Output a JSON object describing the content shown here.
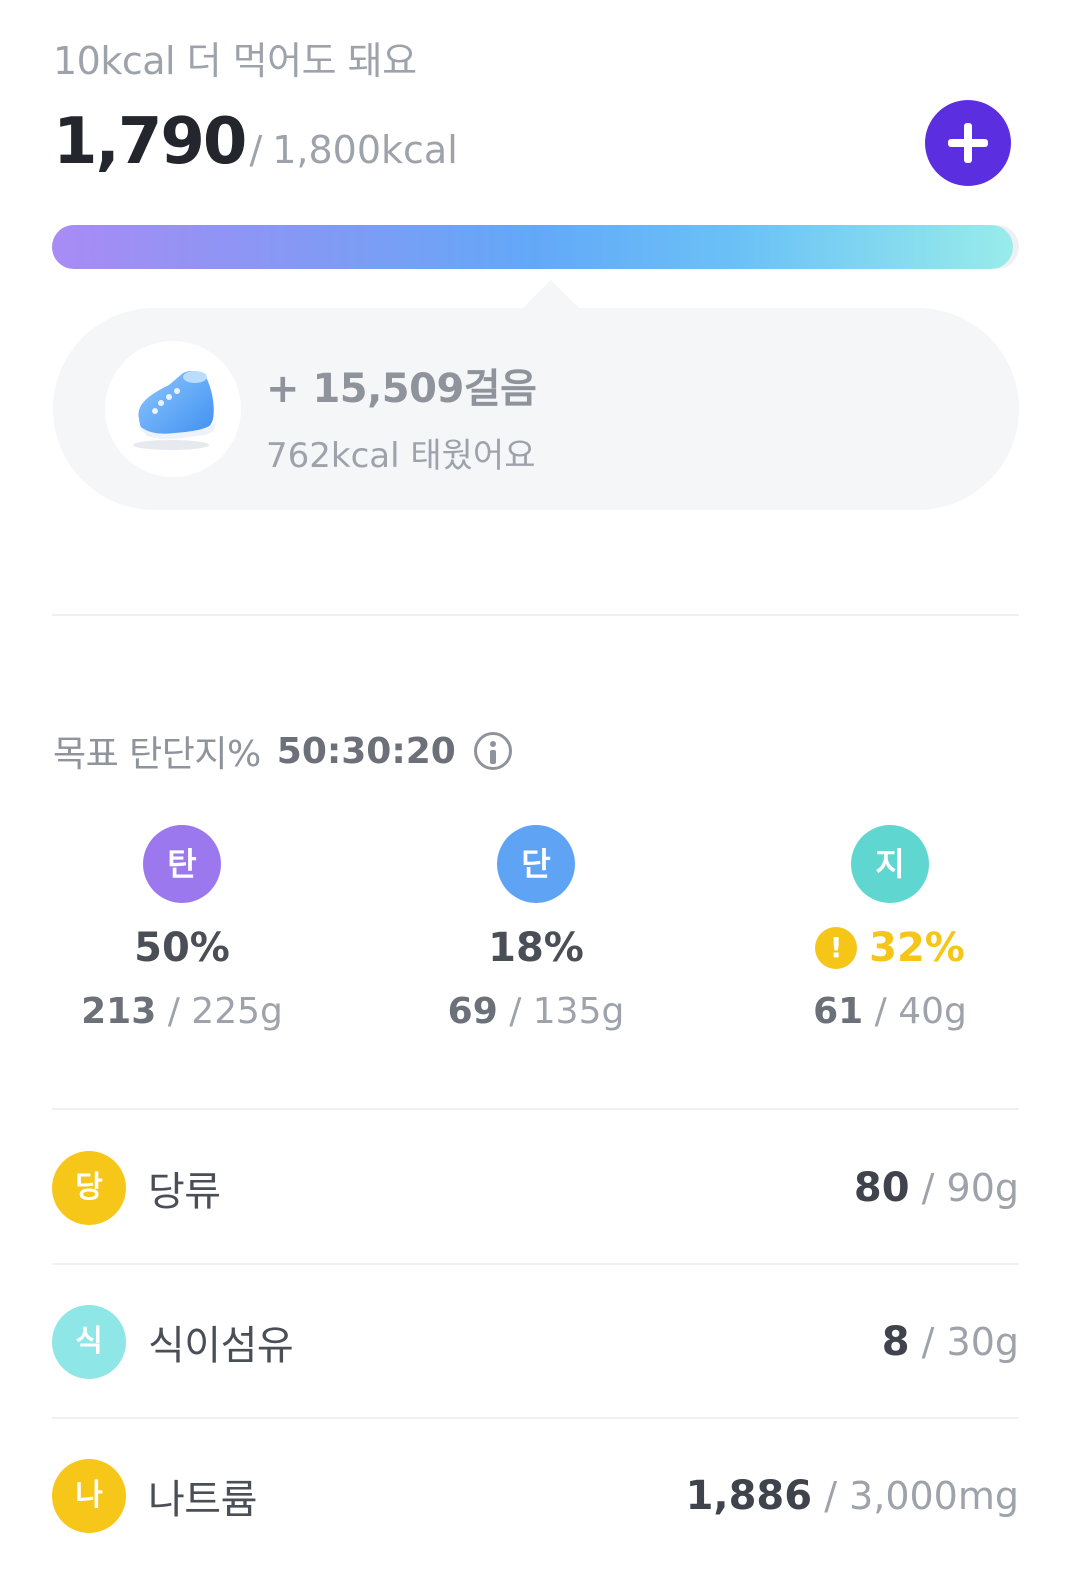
{
  "summary": {
    "remaining_text": "10kcal 더 먹어도 돼요",
    "current_kcal": "1,790",
    "slash": "/",
    "goal_kcal": "1,800kcal",
    "progress_fraction": 0.994
  },
  "steps": {
    "icon": "sneaker-icon",
    "count_text": "+ 15,509걸음",
    "burned_text": "762kcal 태웠어요"
  },
  "macro_goal": {
    "label": "목표 탄단지%",
    "ratio": "50:30:20"
  },
  "macros": [
    {
      "badge": "탄",
      "color": "#9b78ee",
      "percent": "50%",
      "current": "213",
      "goal": "/ 225g",
      "warning": false
    },
    {
      "badge": "단",
      "color": "#5fa3f5",
      "percent": "18%",
      "current": "69",
      "goal": "/ 135g",
      "warning": false
    },
    {
      "badge": "지",
      "color": "#5fd7d0",
      "percent": "32%",
      "current": "61",
      "goal": "/ 40g",
      "warning": true,
      "warning_icon": "!"
    }
  ],
  "nutrients": [
    {
      "badge": "당",
      "color": "#f6c719",
      "label": "당류",
      "current": "80",
      "goal": "/ 90g"
    },
    {
      "badge": "식",
      "color": "#8fe6e6",
      "label": "식이섬유",
      "current": "8",
      "goal": "/ 30g"
    },
    {
      "badge": "나",
      "color": "#f6c719",
      "label": "나트륨",
      "current": "1,886",
      "goal": "/ 3,000mg"
    }
  ],
  "colors": {
    "accent": "#5b2ee0",
    "warning": "#f5c518"
  }
}
